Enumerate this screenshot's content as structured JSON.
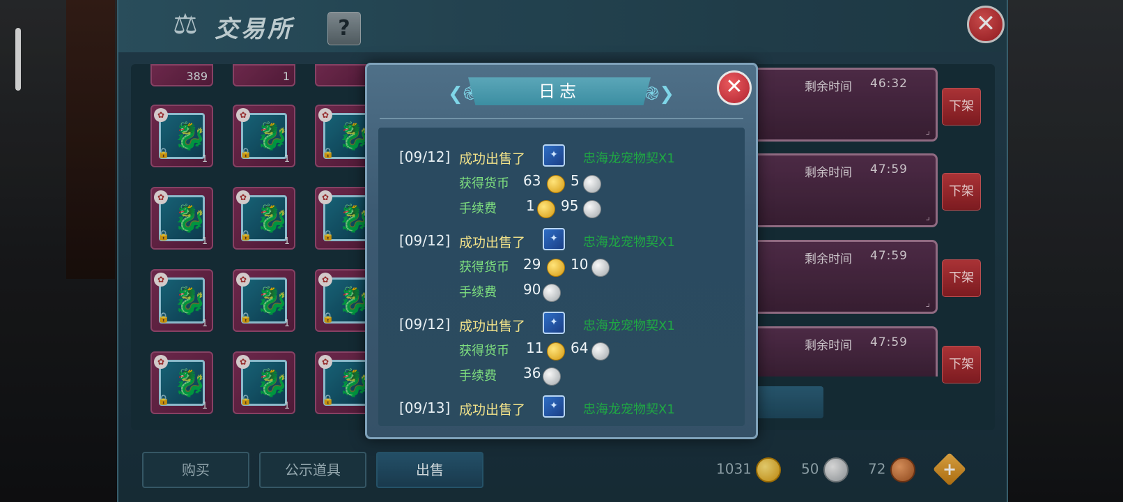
{
  "header": {
    "title": "交易所",
    "title_icon": "scales-icon",
    "help_label": "?",
    "close_label": "✕"
  },
  "grid": {
    "top_row_qty": [
      "389",
      "1",
      "1"
    ],
    "item_qty": "1"
  },
  "listings": [
    {
      "time_label": "剩余时间",
      "time_value": "46:32",
      "button": "下架"
    },
    {
      "time_label": "剩余时间",
      "time_value": "47:59",
      "button": "下架"
    },
    {
      "time_label": "剩余时间",
      "time_value": "47:59",
      "button": "下架"
    },
    {
      "time_label": "剩余时间",
      "time_value": "47:59",
      "button": "下架"
    }
  ],
  "tabs": [
    {
      "label": "购买",
      "active": false
    },
    {
      "label": "公示道具",
      "active": false
    },
    {
      "label": "出售",
      "active": true
    }
  ],
  "currency": {
    "gold": "1031",
    "silver": "50",
    "bronze": "72",
    "add_label": "+"
  },
  "dialog": {
    "title": "日志",
    "close_label": "✕",
    "entries": [
      {
        "date": "[09/12]",
        "action": "成功出售了",
        "item": "忠海龙宠物契X1",
        "earn_label": "获得货币",
        "earn_gold": "63",
        "earn_silver": "5",
        "fee_label": "手续费",
        "fee_gold": "1",
        "fee_silver": "95"
      },
      {
        "date": "[09/12]",
        "action": "成功出售了",
        "item": "忠海龙宠物契X1",
        "earn_label": "获得货币",
        "earn_gold": "29",
        "earn_silver": "10",
        "fee_label": "手续费",
        "fee_gold": "",
        "fee_silver": "90"
      },
      {
        "date": "[09/12]",
        "action": "成功出售了",
        "item": "忠海龙宠物契X1",
        "earn_label": "获得货币",
        "earn_gold": "11",
        "earn_silver": "64",
        "fee_label": "手续费",
        "fee_gold": "",
        "fee_silver": "36"
      },
      {
        "date": "[09/13]",
        "action": "成功出售了",
        "item": "忠海龙宠物契X1"
      }
    ]
  },
  "colors": {
    "item_name_green": "#1fa843",
    "action_yellow": "#f3e38a",
    "label_green": "#7fe07f",
    "close_red": "#b02430"
  }
}
